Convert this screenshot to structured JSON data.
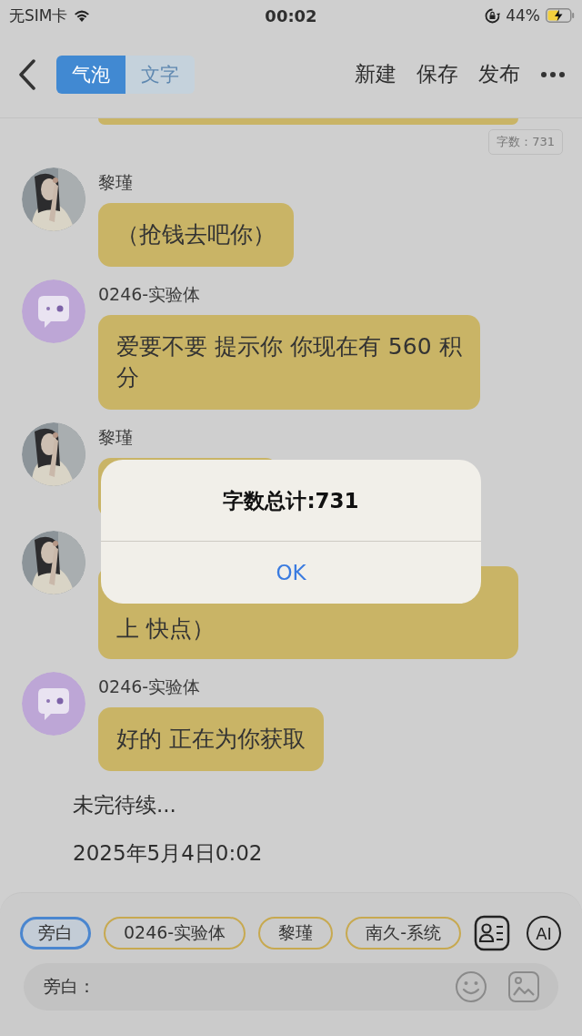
{
  "status_bar": {
    "carrier": "无SIM卡",
    "time": "00:02",
    "battery": "44%"
  },
  "nav": {
    "segments": [
      {
        "label": "气泡",
        "selected": true
      },
      {
        "label": "文字",
        "selected": false
      }
    ],
    "actions": [
      "新建",
      "保存",
      "发布"
    ]
  },
  "word_count": "字数：731",
  "messages": [
    {
      "sender": "黎瑾",
      "text": "（抢钱去吧你）",
      "partial": false
    },
    {
      "sender": "0246-实验体",
      "kind": "bot",
      "text": "爱要不要 提示你 你现在有 560 积分",
      "partial": false
    },
    {
      "sender": "黎瑾",
      "partial": false
    },
    {
      "text": "上 快点）",
      "partial": true
    },
    {
      "sender": "0246-实验体",
      "kind": "bot",
      "text": "好的 正在为你获取",
      "partial": false
    }
  ],
  "narration": [
    "未完待续...",
    "2025年5月4日0:02"
  ],
  "alert": {
    "title": "字数总计:731",
    "button": "OK"
  },
  "roles": [
    {
      "label": "旁白",
      "selected": true
    },
    {
      "label": "0246-实验体",
      "selected": false
    },
    {
      "label": "黎瑾",
      "selected": false
    },
    {
      "label": "南久-系统",
      "selected": false
    }
  ],
  "ai_button": "AI",
  "input": {
    "label": "旁白："
  }
}
